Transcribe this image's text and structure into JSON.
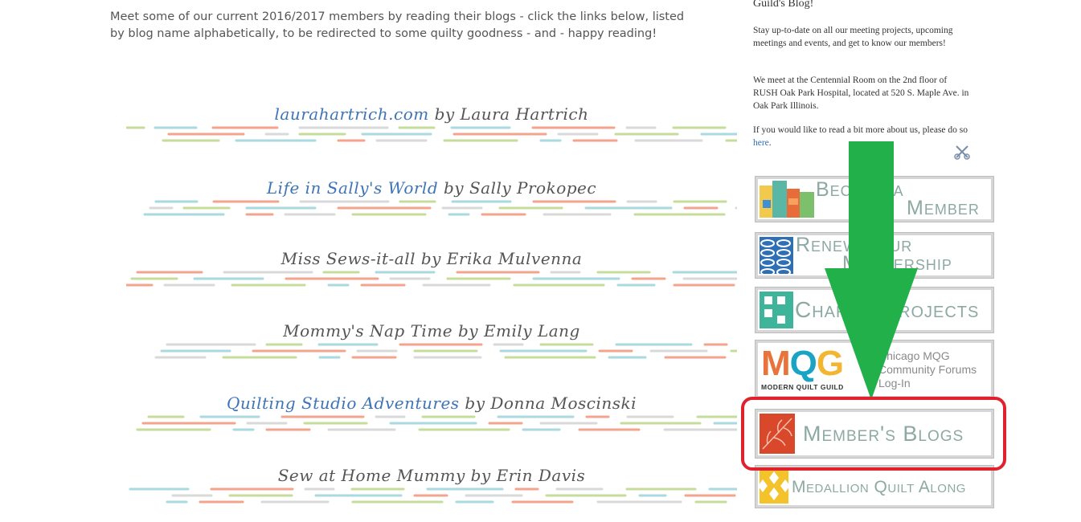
{
  "intro": {
    "text": "Meet some of our current 2016/2017 members by reading their blogs - click the links below, listed by blog name alphabetically, to be redirected to some quilty goodness - and - happy reading!"
  },
  "blogs": [
    {
      "link": "laurahartrich.com",
      "author": " by Laura Hartrich"
    },
    {
      "link": "Life in Sally's World",
      "author": " by Sally Prokopec"
    },
    {
      "link": "",
      "author": "Miss Sews-it-all by Erika Mulvenna"
    },
    {
      "link": "",
      "author": "Mommy's Nap Time by Emily Lang"
    },
    {
      "link": "Quilting Studio Adventures",
      "author": " by Donna Moscinski"
    },
    {
      "link": "",
      "author": "Sew at Home Mummy by Erin Davis"
    }
  ],
  "sidebar": {
    "blog_title": "Guild's Blog!",
    "p1": "Stay up-to-date on all our meeting projects, upcoming meetings and events, and get to know our members!",
    "p2": "We meet at the Centennial Room on the 2nd floor of RUSH Oak Park Hospital, located at 520 S. Maple Ave. in Oak Park Illinois.",
    "p3_before": "If you would like to read a bit more about us, please do so ",
    "p3_link": "here",
    "p3_after": ".",
    "banners": {
      "become_line1": "Become a",
      "become_line2": "Member",
      "renew_line1": "Renew Your",
      "renew_line2": "Membership",
      "charity": "Charity Projects",
      "mqg_letters": [
        "M",
        "Q",
        "G"
      ],
      "mqg_sub": "MODERN QUILT GUILD",
      "mqg_line1": "Chicago MQG",
      "mqg_line2": "Community Forums",
      "mqg_line3": "Log-In",
      "member_blogs": "Member's Blogs",
      "medallion": "Medallion Quilt Along"
    }
  },
  "colors": {
    "link_blue": "#3e74b7",
    "highlight_red": "#e0222e",
    "arrow_green": "#22b04b",
    "stitch_green": "#c6dc9a",
    "stitch_blue": "#a9dae0",
    "stitch_orange": "#f4a38c",
    "stitch_gray": "#d9d9d9"
  },
  "icons": {
    "tool": "scissors-tool-icon",
    "arrow": "down-arrow-icon"
  }
}
